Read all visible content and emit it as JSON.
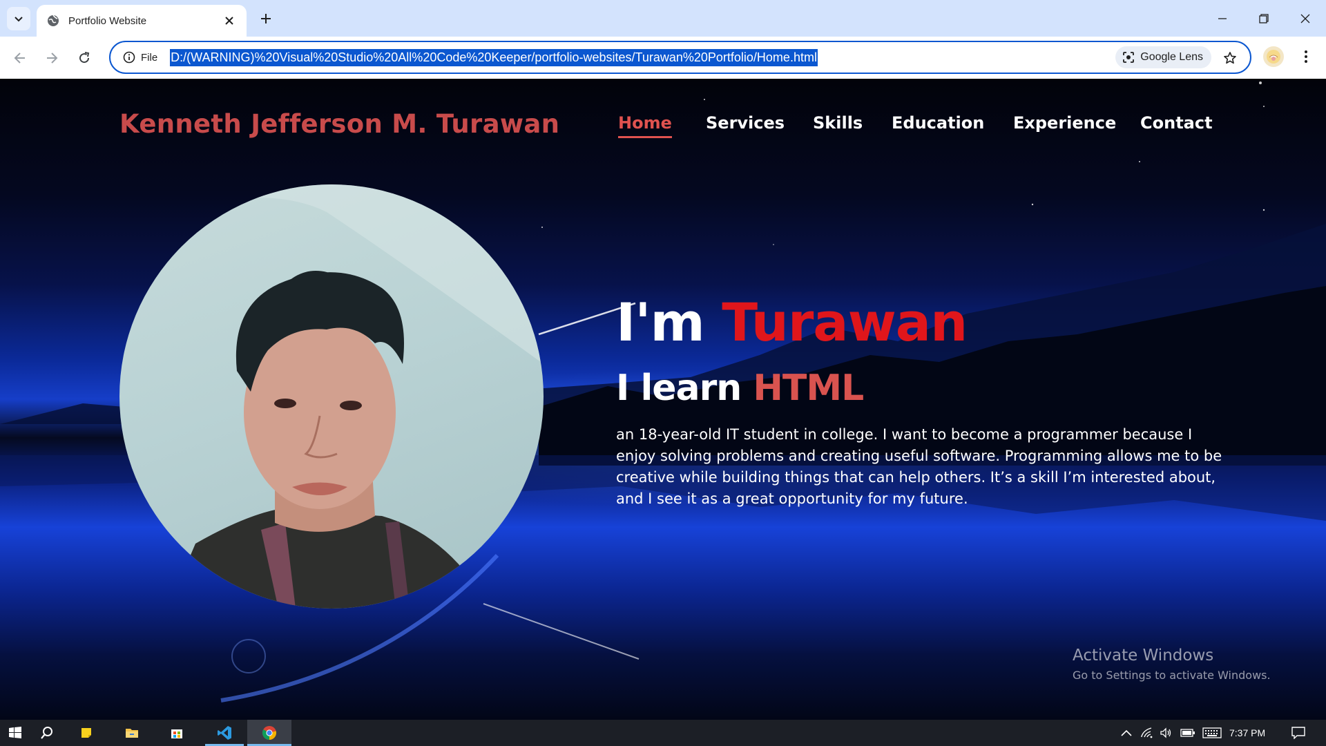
{
  "browser": {
    "tab_title": "Portfolio Website",
    "site_info_label": "File",
    "url": "D:/(WARNING)%20Visual%20Studio%20All%20Code%20Keeper/portfolio-websites/Turawan%20Portfolio/Home.html",
    "lens_label": "Google Lens",
    "icons": [
      "tab-list-icon",
      "globe-icon",
      "close-icon",
      "plus-icon",
      "minimize-icon",
      "restore-icon",
      "window-close-icon",
      "back-icon",
      "forward-icon",
      "reload-icon",
      "info-icon",
      "lens-icon",
      "star-icon",
      "profile-icon",
      "kebab-menu-icon"
    ]
  },
  "page": {
    "brand": "Kenneth Jefferson M. Turawan",
    "nav": [
      {
        "label": "Home",
        "active": true
      },
      {
        "label": "Services",
        "active": false
      },
      {
        "label": "Skills",
        "active": false
      },
      {
        "label": "Education",
        "active": false
      },
      {
        "label": "Experience",
        "active": false
      },
      {
        "label": "Contact",
        "active": false
      }
    ],
    "hero": {
      "greeting": "I'm",
      "name": "Turawan",
      "learn_prefix": "I learn",
      "learn_lang": "HTML",
      "bio": "an 18-year-old IT student in college. I want to become a programmer because I enjoy solving problems and creating useful software. Programming allows me to be creative while building things that can help others. It’s a skill I’m interested about, and I see it as a great opportunity for my future."
    },
    "colors": {
      "brand": "#c84b4b",
      "accent": "#e0161b",
      "nav_active": "#e0524f",
      "lang": "#d9534f",
      "text": "#ffffff"
    }
  },
  "watermark": {
    "title": "Activate Windows",
    "subtitle": "Go to Settings to activate Windows."
  },
  "taskbar": {
    "time": "7:37 PM",
    "apps": [
      "windows-start-icon",
      "search-icon",
      "sticky-notes-icon",
      "file-explorer-icon",
      "microsoft-store-icon",
      "vscode-icon",
      "chrome-icon"
    ],
    "tray": [
      "chevron-up-icon",
      "wifi-icon",
      "volume-icon",
      "battery-icon",
      "keyboard-icon",
      "notification-icon"
    ]
  }
}
